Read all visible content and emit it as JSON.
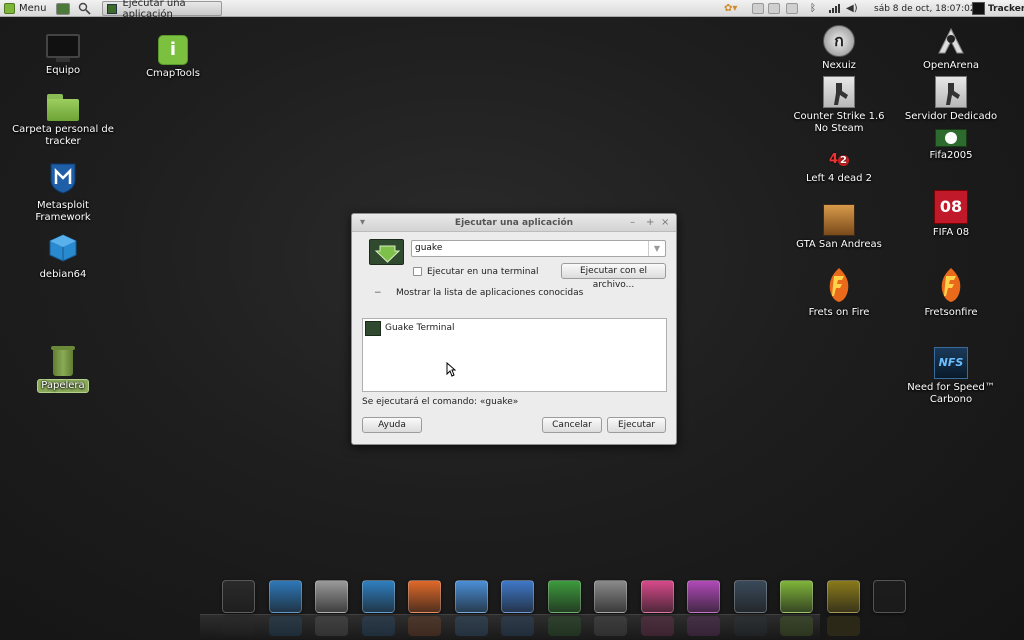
{
  "top_panel": {
    "menu_label": "Menu",
    "task_label": "Ejecutar una aplicación",
    "datetime": "sáb  8 de oct, 18:07:02",
    "user": "Tracker"
  },
  "desktop_left": [
    {
      "label": "Equipo"
    },
    {
      "label": "CmapTools"
    },
    {
      "label": "Carpeta personal de",
      "label2": "tracker"
    },
    {
      "label": "Metasploit",
      "label2": "Framework"
    },
    {
      "label": "debian64"
    },
    {
      "label": "Papelera"
    }
  ],
  "desktop_right": [
    {
      "label": "Nexuiz"
    },
    {
      "label": "OpenArena"
    },
    {
      "label": "Counter Strike 1.6",
      "label2": "No Steam"
    },
    {
      "label": "Servidor Dedicado"
    },
    {
      "label": "Fifa2005"
    },
    {
      "label": "Left 4 dead 2"
    },
    {
      "label": "GTA San Andreas"
    },
    {
      "label": "FIFA 08"
    },
    {
      "label": "Frets on Fire"
    },
    {
      "label": "Fretsonfire"
    },
    {
      "label": "Need for Speed™",
      "label2": "Carbono"
    }
  ],
  "dialog": {
    "title": "Ejecutar una aplicación",
    "command_value": "guake",
    "run_in_terminal": "Ejecutar en una terminal",
    "run_with_file": "Ejecutar con el archivo...",
    "show_list": "Mostrar la lista de aplicaciones conocidas",
    "app_item": "Guake Terminal",
    "status": "Se ejecutará el comando: «guake»",
    "help": "Ayuda",
    "cancel": "Cancelar",
    "run": "Ejecutar"
  },
  "dock": [
    {
      "name": "terminal-icon",
      "color": "#2a2a2a"
    },
    {
      "name": "network-tool-icon",
      "color": "#2e78b8"
    },
    {
      "name": "settings-tools-icon",
      "color": "#9a9a9a"
    },
    {
      "name": "system-monitor-icon",
      "color": "#2f7fc0"
    },
    {
      "name": "firefox-icon",
      "color": "#e0692a"
    },
    {
      "name": "chromium-icon",
      "color": "#4a8fd8"
    },
    {
      "name": "writer-icon",
      "color": "#3f78c8"
    },
    {
      "name": "calc-icon",
      "color": "#3d9a3d"
    },
    {
      "name": "calculator-icon",
      "color": "#8a8a8a"
    },
    {
      "name": "color-picker-icon",
      "color": "#d84a8a"
    },
    {
      "name": "emoticon-chat-icon",
      "color": "#b04ab8"
    },
    {
      "name": "pointer-icon",
      "color": "#3a4a5a"
    },
    {
      "name": "mint-logo-icon",
      "color": "#7fb53a"
    },
    {
      "name": "game-icon",
      "color": "#8a7a1a"
    },
    {
      "name": "power-icon",
      "color": "#1c1c1c"
    }
  ]
}
